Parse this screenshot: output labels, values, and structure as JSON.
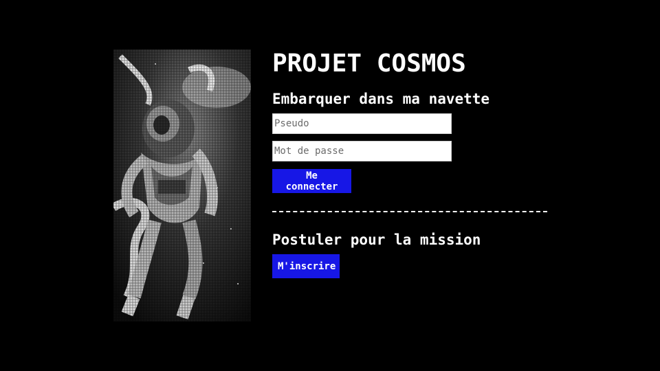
{
  "image": {
    "icon": "astronaut-image",
    "alt": "Astronaute en apesanteur"
  },
  "header": {
    "title": "PROJET COSMOS"
  },
  "login": {
    "subtitle": "Embarquer dans ma navette",
    "username_placeholder": "Pseudo",
    "password_placeholder": "Mot de passe",
    "submit_label": "Me connecter"
  },
  "signup": {
    "subtitle": "Postuler pour la mission",
    "submit_label": "M'inscrire"
  },
  "colors": {
    "background": "#000000",
    "text": "#ffffff",
    "button": "#1717e6"
  }
}
